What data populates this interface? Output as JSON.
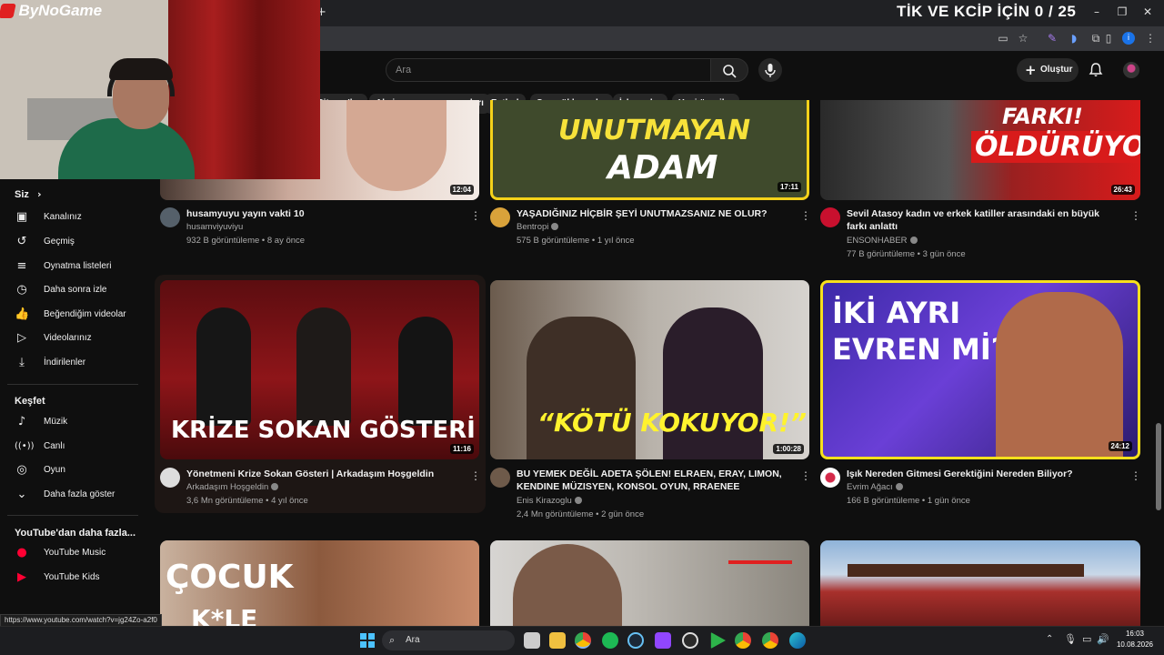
{
  "overlay": {
    "logo_text": "ByNoGame",
    "counter_title": "TİK VE KCİP İÇİN 0 / 25"
  },
  "header": {
    "search_placeholder": "Ara",
    "create_label": "Oluştur"
  },
  "chips": [
    "Sitcom'lar",
    "Aksiyon-macera oyunları",
    "Futbol",
    "Son yüklenenler",
    "İzlenenler",
    "Yeni öneriler"
  ],
  "sidebar": {
    "you_heading": "Siz",
    "you_items": [
      {
        "label": "Kanalınız",
        "icon": "channel-icon"
      },
      {
        "label": "Geçmiş",
        "icon": "history-icon"
      },
      {
        "label": "Oynatma listeleri",
        "icon": "playlists-icon"
      },
      {
        "label": "Daha sonra izle",
        "icon": "watch-later-icon"
      },
      {
        "label": "Beğendiğim videolar",
        "icon": "like-icon"
      },
      {
        "label": "Videolarınız",
        "icon": "your-videos-icon"
      },
      {
        "label": "İndirilenler",
        "icon": "download-icon"
      }
    ],
    "explore_heading": "Keşfet",
    "explore_items": [
      {
        "label": "Müzik",
        "icon": "music-icon"
      },
      {
        "label": "Canlı",
        "icon": "live-icon"
      },
      {
        "label": "Oyun",
        "icon": "gaming-icon"
      },
      {
        "label": "Daha fazla göster",
        "icon": "chevron-down-icon"
      }
    ],
    "more_heading": "YouTube'dan daha fazla...",
    "more_items": [
      {
        "label": "YouTube Music",
        "icon": "youtube-music-icon"
      },
      {
        "label": "YouTube Kids",
        "icon": "youtube-kids-icon"
      }
    ]
  },
  "videos": [
    {
      "title": "husamyuyu yayın vakti 10",
      "channel": "husamviyuviyu",
      "meta": "932 B görüntüleme • 8 ay önce",
      "duration": "12:04",
      "verified": false
    },
    {
      "title": "YAŞADIĞINIZ HİÇBİR ŞEYİ UNUTMAZSANIZ NE OLUR?",
      "channel": "Bentropi",
      "meta": "575 B görüntüleme • 1 yıl önce",
      "duration": "17:11",
      "verified": true,
      "thumb_text_1": "UNUTMAYAN",
      "thumb_text_2": "ADAM"
    },
    {
      "title": "Sevil Atasoy kadın ve erkek katiller arasındaki en büyük farkı anlattı",
      "channel": "ENSONHABER",
      "meta": "77 B görüntüleme • 3 gün önce",
      "duration": "26:43",
      "verified": true,
      "thumb_text_1": "FARKI!",
      "thumb_text_2": "ÖLDÜRÜYOR!"
    },
    {
      "title": "Yönetmeni Krize Sokan Gösteri | Arkadaşım Hoşgeldin",
      "channel": "Arkadaşım Hoşgeldin",
      "meta": "3,6 Mn görüntüleme • 4 yıl önce",
      "duration": "11:16",
      "verified": true,
      "thumb_text_1": "KRİZE SOKAN GÖSTERİ"
    },
    {
      "title": "BU YEMEK DEĞİL ADETA ŞÖLEN! ELRAEN, ERAY, LIMON, KENDINE MÜZISYEN, KONSOL OYUN, RRAENEE",
      "channel": "Enis Kirazoglu",
      "meta": "2,4 Mn görüntüleme • 2 gün önce",
      "duration": "1:00:28",
      "verified": true,
      "thumb_text_1": "“KÖTÜ KOKUYOR!”"
    },
    {
      "title": "Işık Nereden Gitmesi Gerektiğini Nereden Biliyor?",
      "channel": "Evrim Ağacı",
      "meta": "166 B görüntüleme • 1 gün önce",
      "duration": "24:12",
      "verified": true,
      "thumb_text_1": "İKİ AYRI",
      "thumb_text_2": "EVREN Mİ?"
    },
    {
      "thumb_text_1": "ÇOCUK",
      "thumb_text_2": "K*LE"
    }
  ],
  "status_url": "https://www.youtube.com/watch?v=jg24Zo-a2f0",
  "taskbar": {
    "search_label": "Ara",
    "time": "16:03",
    "date": "10.08.2026"
  },
  "colors": {
    "background": "#0f0f0f",
    "chip": "#272727",
    "accent_red": "#ff0000"
  }
}
